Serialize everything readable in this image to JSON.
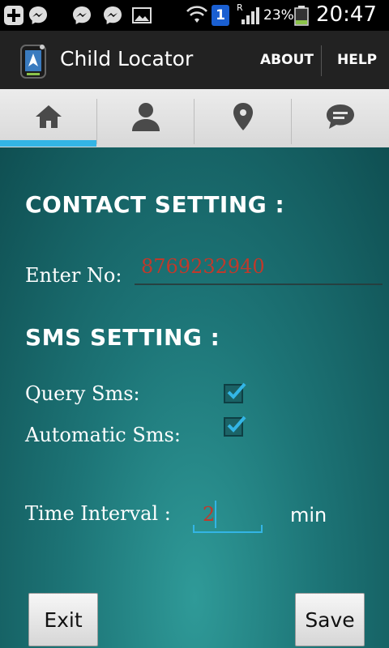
{
  "status_bar": {
    "battery_percent": "23%",
    "sim_badge": "1",
    "roaming": "R",
    "time": "20:47"
  },
  "app_bar": {
    "title": "Child Locator",
    "about_label": "ABOUT",
    "help_label": "HELP"
  },
  "tabs": [
    {
      "icon": "home-icon",
      "selected": true
    },
    {
      "icon": "person-icon",
      "selected": false
    },
    {
      "icon": "location-pin-icon",
      "selected": false
    },
    {
      "icon": "chat-bubble-icon",
      "selected": false
    }
  ],
  "contact_setting": {
    "heading": "CONTACT SETTING :",
    "number_label": "Enter No:",
    "number_value": "8769232940"
  },
  "sms_setting": {
    "heading": "SMS  SETTING :",
    "query_label": "Query Sms:",
    "query_checked": true,
    "automatic_label": "Automatic Sms:",
    "automatic_checked": true,
    "interval_label": "Time Interval :",
    "interval_value": "2",
    "interval_unit": "min"
  },
  "buttons": {
    "exit_label": "Exit",
    "save_label": "Save"
  },
  "colors": {
    "accent": "#33b5e5",
    "input_text": "#c0392b",
    "background": "#1d7577"
  }
}
